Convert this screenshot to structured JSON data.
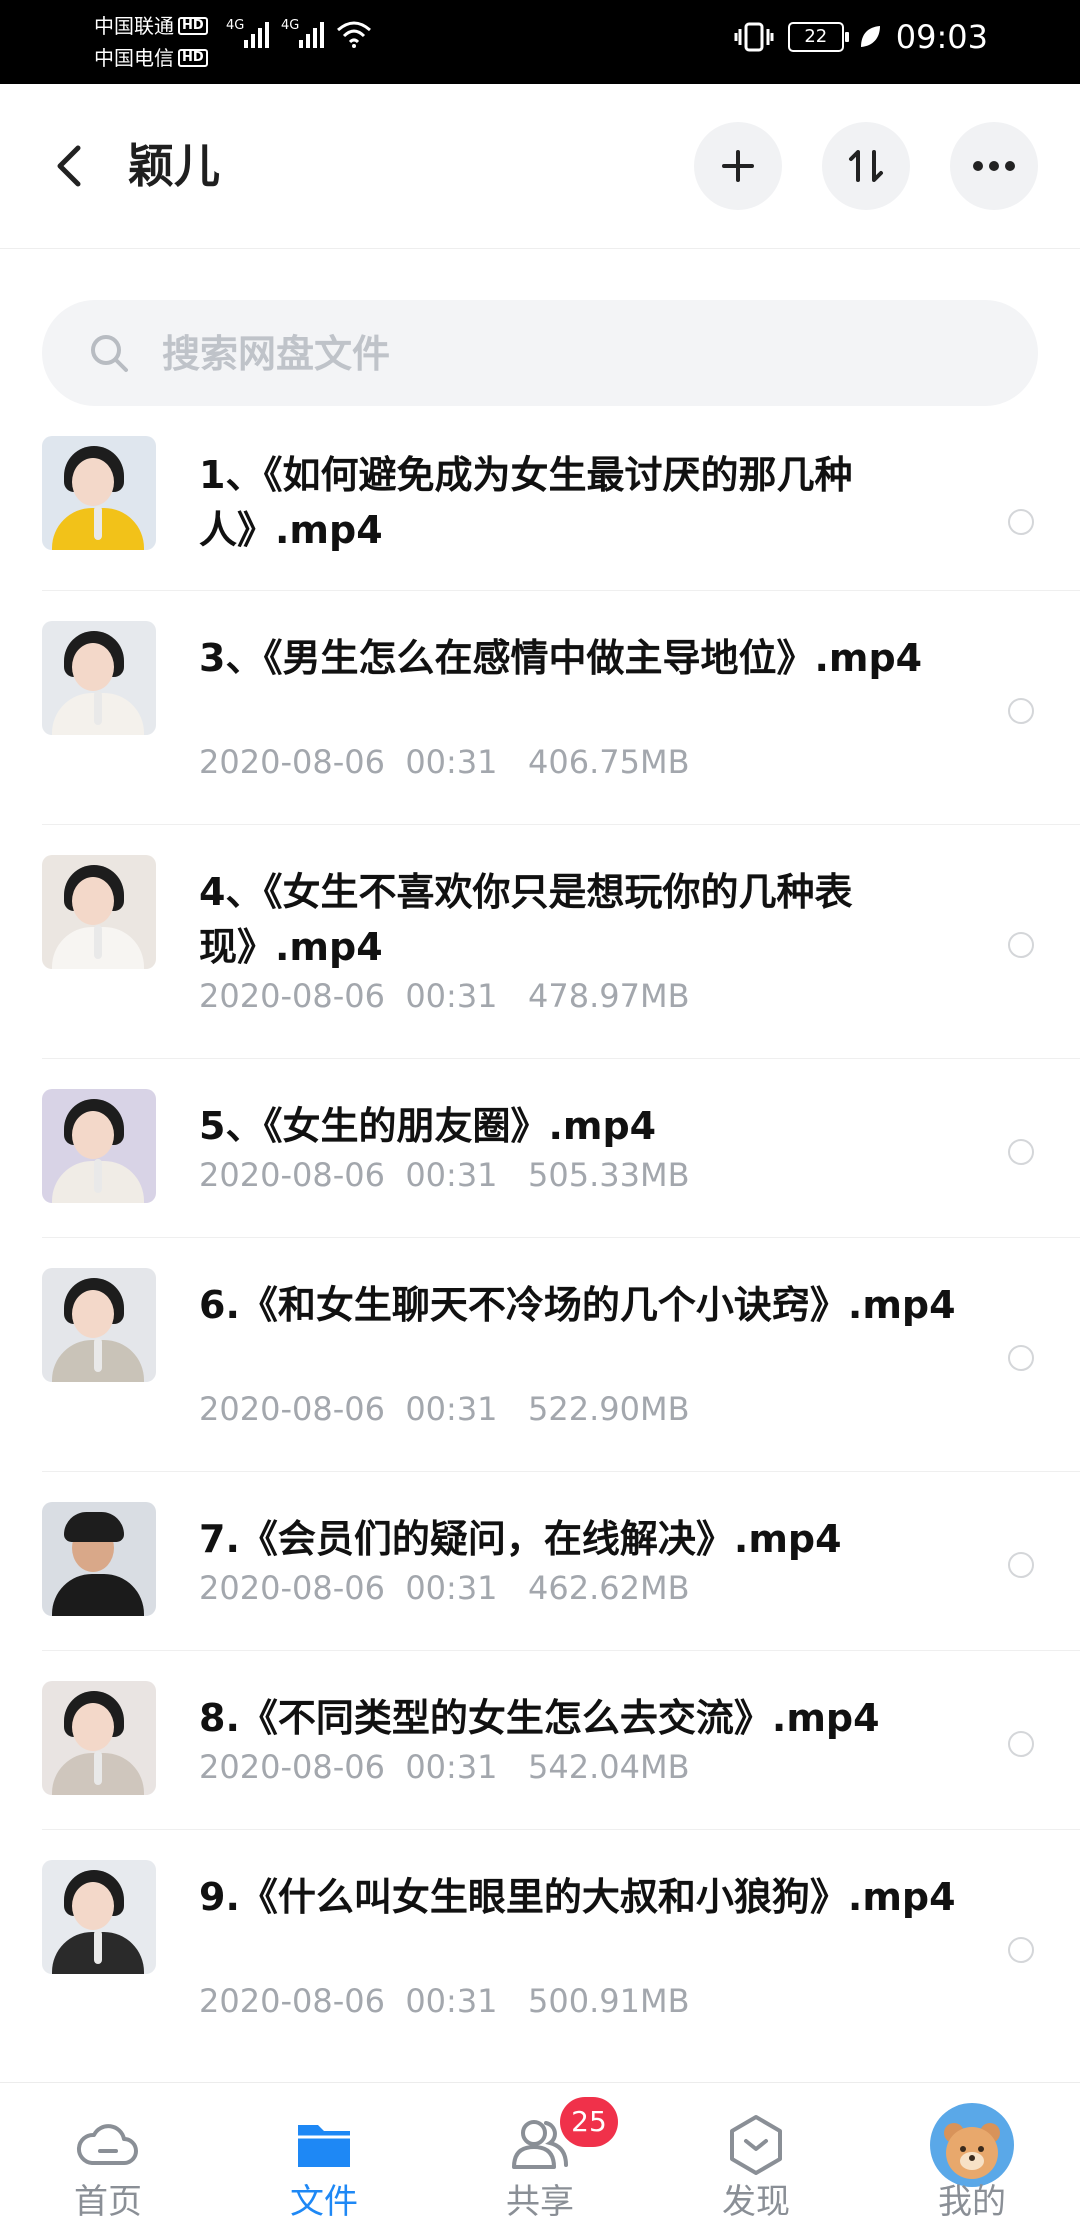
{
  "status_bar": {
    "carrier1": "中国联通",
    "carrier2": "中国电信",
    "hd": "HD",
    "network": "4G",
    "battery": "22",
    "time": "09:03"
  },
  "header": {
    "title": "颖儿"
  },
  "search": {
    "placeholder": "搜索网盘文件"
  },
  "files": [
    {
      "name": "1、《如何避免成为女生最讨厌的那几种人》.mp4",
      "date": "",
      "time": "",
      "size": ""
    },
    {
      "name": "3、《男生怎么在感情中做主导地位》.mp4",
      "date": "2020-08-06",
      "time": "00:31",
      "size": "406.75MB"
    },
    {
      "name": "4、《女生不喜欢你只是想玩你的几种表现》.mp4",
      "date": "2020-08-06",
      "time": "00:31",
      "size": "478.97MB"
    },
    {
      "name": "5、《女生的朋友圈》.mp4",
      "date": "2020-08-06",
      "time": "00:31",
      "size": "505.33MB"
    },
    {
      "name": "6.《和女生聊天不冷场的几个小诀窍》.mp4",
      "date": "2020-08-06",
      "time": "00:31",
      "size": "522.90MB"
    },
    {
      "name": "7.《会员们的疑问，在线解决》.mp4",
      "date": "2020-08-06",
      "time": "00:31",
      "size": "462.62MB"
    },
    {
      "name": "8.《不同类型的女生怎么去交流》.mp4",
      "date": "2020-08-06",
      "time": "00:31",
      "size": "542.04MB"
    },
    {
      "name": "9.《什么叫女生眼里的大叔和小狼狗》.mp4",
      "date": "2020-08-06",
      "time": "00:31",
      "size": "500.91MB"
    }
  ],
  "bottom_nav": {
    "home": "首页",
    "files": "文件",
    "share": "共享",
    "share_badge": "25",
    "discover": "发现",
    "mine": "我的"
  },
  "colors": {
    "accent": "#1e88f5",
    "badge": "#f0314a",
    "meta_text": "#a3a7ad"
  }
}
